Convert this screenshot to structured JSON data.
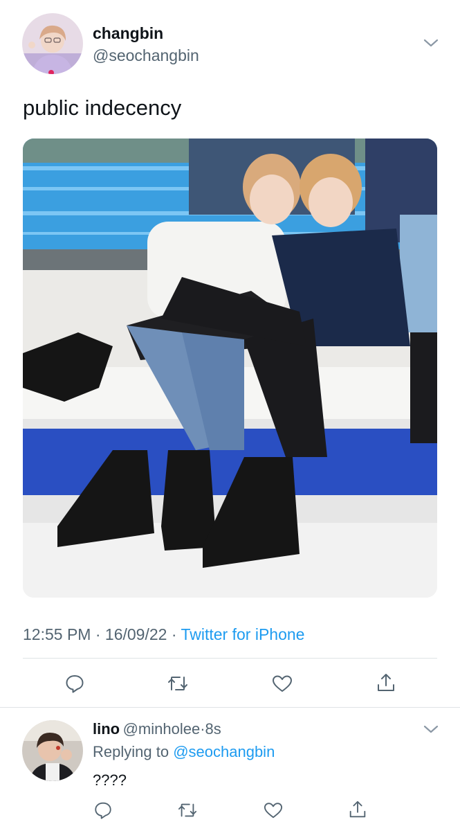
{
  "tweet": {
    "author_name": "changbin",
    "author_handle": "@seochangbin",
    "text": "public indecency",
    "time": "12:55 PM",
    "date": "16/09/22",
    "source": "Twitter for iPhone",
    "meta_sep": "·"
  },
  "reply": {
    "author_name": "lino",
    "author_handle": "@minholee",
    "time_ago": "8s",
    "sep": "·",
    "replying_prefix": "Replying to",
    "replying_handle": "@seochangbin",
    "text": "????"
  },
  "icons": {
    "reply": "reply-icon",
    "retweet": "retweet-icon",
    "like": "heart-icon",
    "share": "share-icon",
    "more": "chevron-down-icon"
  },
  "colors": {
    "link": "#1d9bf0",
    "secondary_text": "#536471",
    "primary_text": "#0f1419",
    "divider": "#dfe3e6"
  }
}
